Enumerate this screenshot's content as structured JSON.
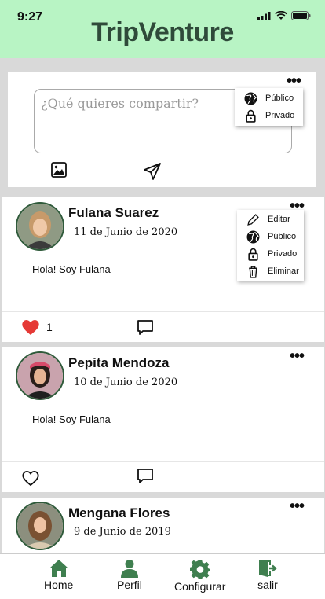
{
  "status": {
    "time": "9:27"
  },
  "app": {
    "title": "TripVenture"
  },
  "composer": {
    "placeholder": "¿Qué quieres  compartir?",
    "visibility_menu": [
      "Público",
      "Privado"
    ]
  },
  "post_menu": [
    "Editar",
    "Público",
    "Privado",
    "Eliminar"
  ],
  "posts": [
    {
      "name": "Fulana Suarez",
      "date": "11 de Junio de 2020",
      "text": "Hola! Soy Fulana",
      "likes": "1",
      "liked": true
    },
    {
      "name": "Pepita Mendoza",
      "date": "10 de Junio de 2020",
      "text": "Hola! Soy Fulana",
      "liked": false
    },
    {
      "name": "Mengana Flores",
      "date": "9 de Junio de 2019"
    }
  ],
  "nav": [
    {
      "label": "Home",
      "icon": "home-icon"
    },
    {
      "label": "Perfil",
      "icon": "user-icon"
    },
    {
      "label": "Configurar",
      "icon": "gear-icon"
    },
    {
      "label": "salir",
      "icon": "exit-icon"
    }
  ],
  "colors": {
    "header": "#b8f4c4",
    "accent": "#3f7f4f",
    "like": "#e53935"
  }
}
